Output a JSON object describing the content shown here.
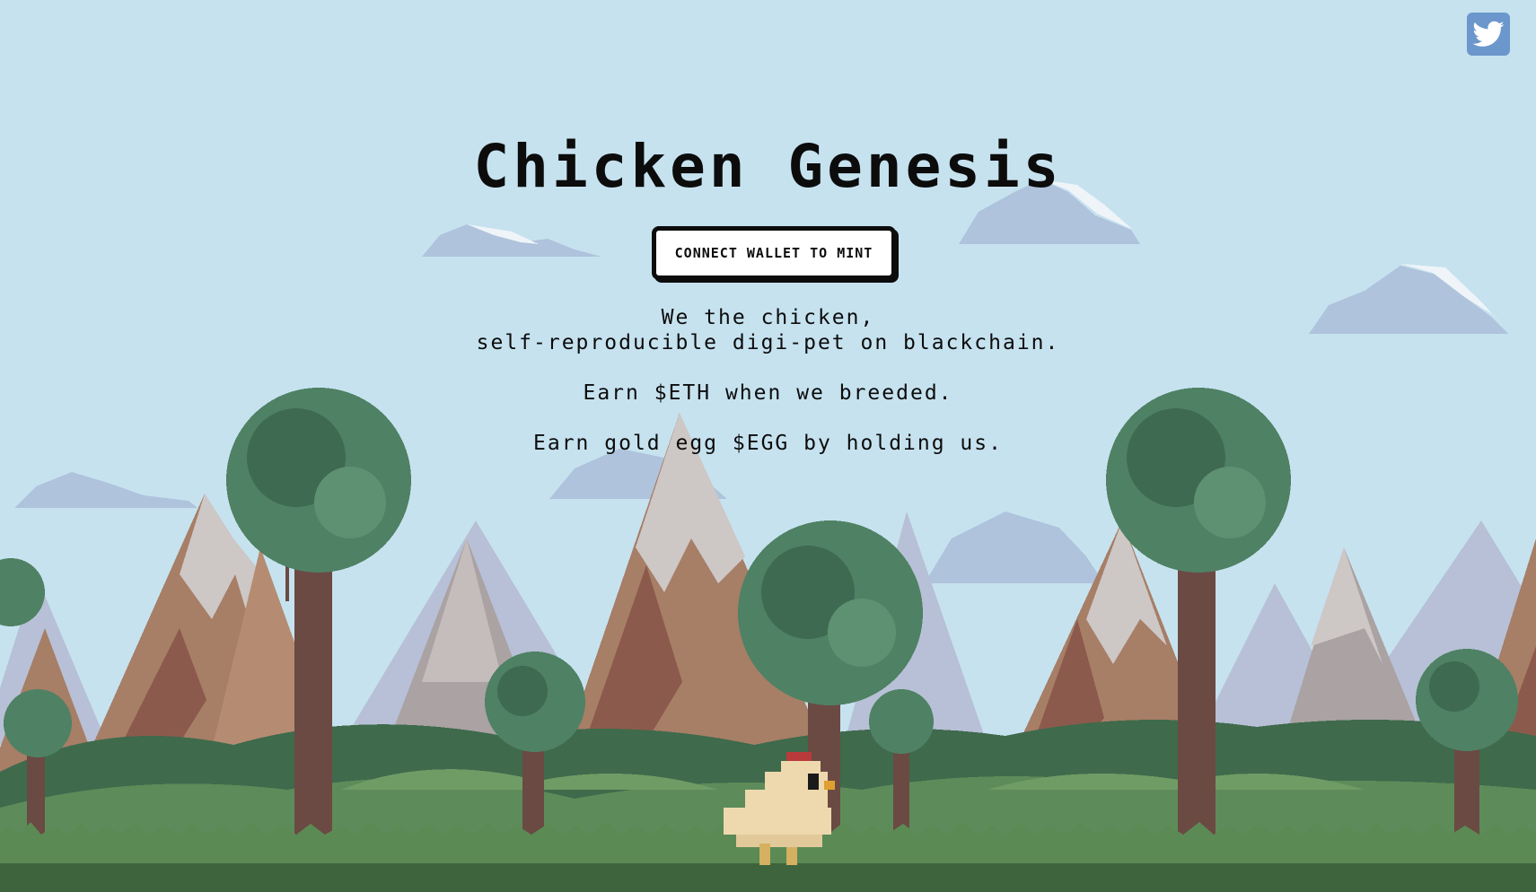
{
  "page": {
    "title": "Chicken Genesis",
    "mint_button_label": "CONNECT WALLET TO MINT",
    "taglines": [
      "We the chicken,",
      "self-reproducible digi-pet on blackchain.",
      "Earn $ETH when we breeded.",
      "Earn gold egg $EGG by holding us."
    ]
  },
  "social": {
    "twitter_icon": "twitter-bird-icon"
  },
  "colors": {
    "sky": "#c6e2ef",
    "text": "#0c0c0c",
    "button_bg": "#ffffff",
    "twitter_bg": "#6b97cc",
    "tree_foliage": "#4f8164",
    "mountain_brown": "#a77e66",
    "grass": "#4e7a4b",
    "chicken_body": "#eed9ae",
    "chicken_comb": "#b83a3a"
  }
}
